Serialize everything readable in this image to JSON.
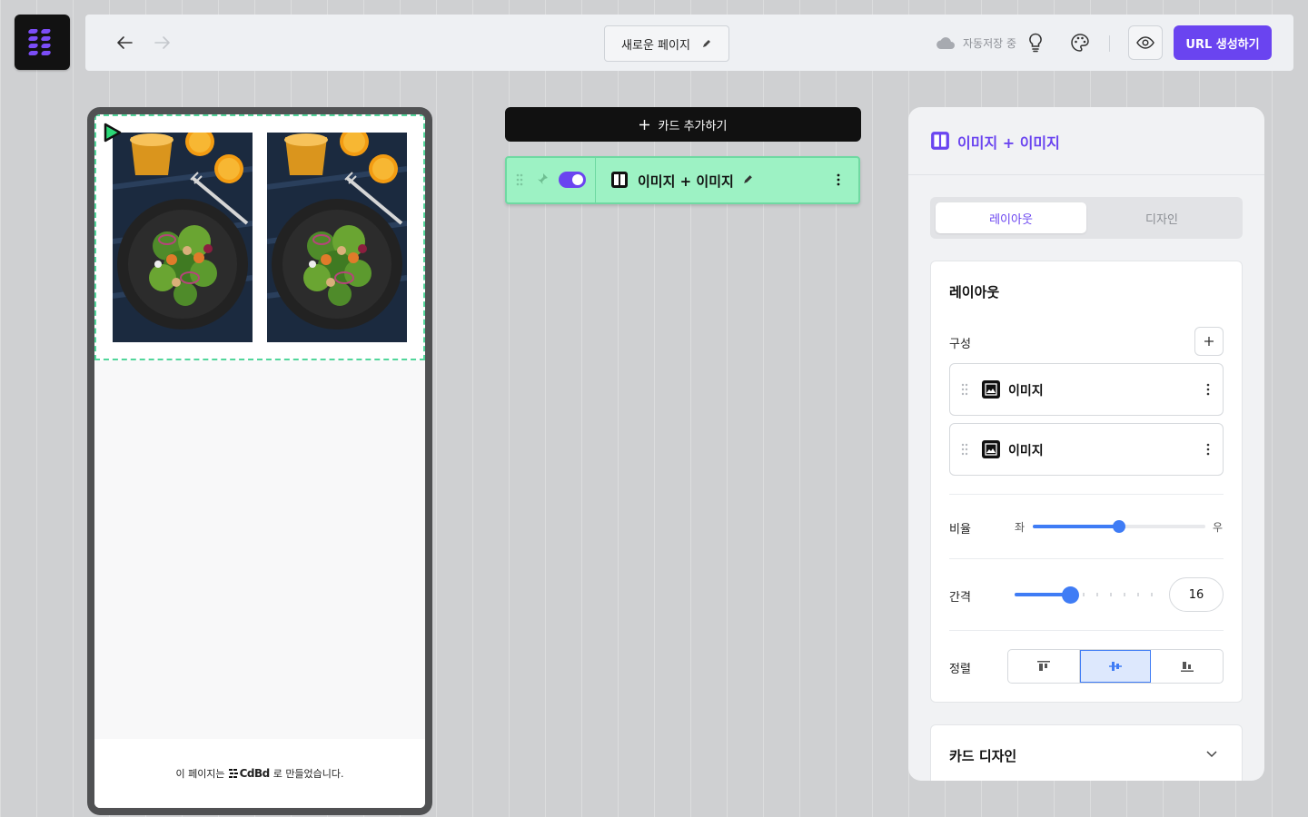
{
  "app": {
    "logo_icon": "cdbd-logo-icon",
    "accent_color": "#6a44f0"
  },
  "topbar": {
    "back_icon": "arrow-left-icon",
    "forward_icon": "arrow-right-icon",
    "page_title": "새로운 페이지",
    "edit_icon": "pencil-icon",
    "autosave_label": "자동저장 중",
    "cloud_icon": "cloud-icon",
    "bulb_icon": "lightbulb-icon",
    "palette_icon": "palette-icon",
    "preview_icon": "eye-icon",
    "url_button": "URL 생성하기"
  },
  "preview": {
    "footer_prefix": "이 페이지는",
    "footer_brand": "CdBd",
    "footer_suffix": "로 만들었습니다.",
    "images": [
      "salad-photo",
      "salad-photo"
    ]
  },
  "cards": {
    "add_button": "카드 추가하기",
    "items": [
      {
        "title": "이미지 + 이미지",
        "enabled": true,
        "color": "#9df2c4"
      }
    ]
  },
  "panel": {
    "title": "이미지 + 이미지",
    "tabs": [
      {
        "label": "레이아웃",
        "active": true
      },
      {
        "label": "디자인",
        "active": false
      }
    ],
    "layout": {
      "heading": "레이아웃",
      "composition_label": "구성",
      "components": [
        {
          "label": "이미지",
          "icon": "image-icon"
        },
        {
          "label": "이미지",
          "icon": "image-icon"
        }
      ],
      "ratio_label": "비율",
      "ratio_left": "좌",
      "ratio_right": "우",
      "ratio_value": 0.5,
      "gap_label": "간격",
      "gap_value": "16",
      "align_label": "정렬",
      "align_options": [
        "align-top-icon",
        "align-center-icon",
        "align-bottom-icon"
      ],
      "align_selected": 1
    },
    "card_design_label": "카드 디자인"
  }
}
